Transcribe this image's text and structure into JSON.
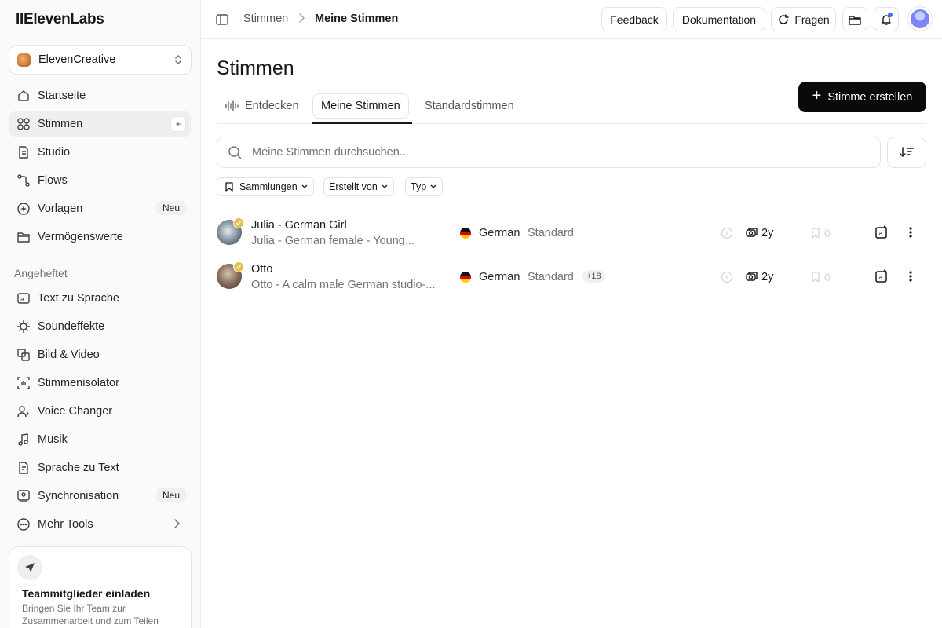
{
  "brand": {
    "logo": "IIElevenLabs"
  },
  "workspace": {
    "name": "ElevenCreative"
  },
  "sidebar": {
    "nav": [
      {
        "label": "Startseite"
      },
      {
        "label": "Stimmen"
      },
      {
        "label": "Studio"
      },
      {
        "label": "Flows"
      },
      {
        "label": "Vorlagen",
        "badge": "Neu"
      },
      {
        "label": "Vermögenswerte"
      }
    ],
    "pinned_label": "Angeheftet",
    "pinned": [
      {
        "label": "Text zu Sprache"
      },
      {
        "label": "Soundeffekte"
      },
      {
        "label": "Bild & Video"
      },
      {
        "label": "Stimmenisolator"
      },
      {
        "label": "Voice Changer"
      },
      {
        "label": "Musik"
      },
      {
        "label": "Sprache zu Text"
      },
      {
        "label": "Synchronisation",
        "badge": "Neu"
      },
      {
        "label": "Mehr Tools"
      }
    ],
    "invite": {
      "title": "Teammitglieder einladen",
      "desc": "Bringen Sie Ihr Team zur Zusammenarbeit und zum Teilen"
    }
  },
  "header": {
    "breadcrumb": [
      "Stimmen",
      "Meine Stimmen"
    ],
    "feedback": "Feedback",
    "docs": "Dokumentation",
    "ask": "Fragen"
  },
  "main": {
    "title": "Stimmen",
    "tabs": [
      "Entdecken",
      "Meine Stimmen",
      "Standardstimmen"
    ],
    "create_label": "Stimme erstellen",
    "search_placeholder": "Meine Stimmen durchsuchen...",
    "filters": [
      "Sammlungen",
      "Erstellt von",
      "Typ"
    ]
  },
  "voices": [
    {
      "name": "Julia - German Girl",
      "desc": "Julia - German female - Young...",
      "lang": "German",
      "category": "Standard",
      "extra": "",
      "age": "2y",
      "bookmarks": "0"
    },
    {
      "name": "Otto",
      "desc": "Otto - A calm male German studio-...",
      "lang": "German",
      "category": "Standard",
      "extra": "+18",
      "age": "2y",
      "bookmarks": "0"
    }
  ],
  "colors": {
    "accent": "#0a0a0a",
    "verified": "#e5c04b",
    "notification": "#3b6cf6"
  }
}
